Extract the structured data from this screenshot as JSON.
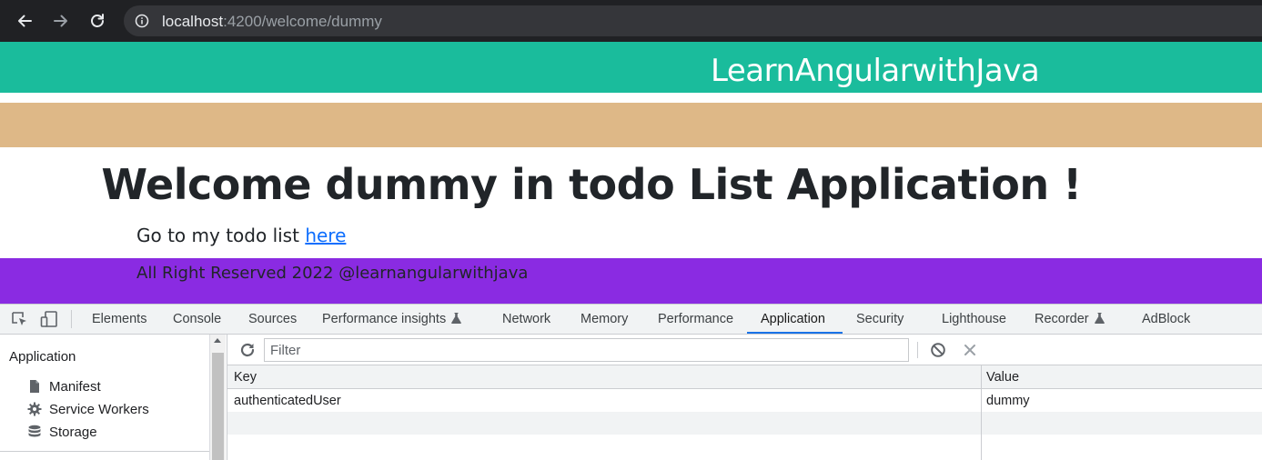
{
  "browser": {
    "url_host": "localhost",
    "url_rest": ":4200/welcome/dummy"
  },
  "page": {
    "brand": "LearnAngularwithJava",
    "welcome_title": "Welcome dummy in todo List Application !",
    "todo_text": "Go to my todo list",
    "todo_link": "here",
    "footer": "All Right Reserved 2022 @learnangularwithjava",
    "colors": {
      "header": "#1abc9c",
      "band": "#deb887",
      "footer": "#8a2be2"
    }
  },
  "devtools": {
    "tabs": [
      {
        "label": "Elements"
      },
      {
        "label": "Console"
      },
      {
        "label": "Sources"
      },
      {
        "label": "Performance insights"
      },
      {
        "label": "Network"
      },
      {
        "label": "Memory"
      },
      {
        "label": "Performance"
      },
      {
        "label": "Application",
        "active": true
      },
      {
        "label": "Security"
      },
      {
        "label": "Lighthouse"
      },
      {
        "label": "Recorder"
      },
      {
        "label": "AdBlock"
      }
    ],
    "sidebar": {
      "heading": "Application",
      "items": [
        {
          "label": "Manifest",
          "icon": "file-icon"
        },
        {
          "label": "Service Workers",
          "icon": "gear-icon"
        },
        {
          "label": "Storage",
          "icon": "database-icon"
        }
      ]
    },
    "filter_placeholder": "Filter",
    "table": {
      "columns": [
        "Key",
        "Value"
      ],
      "rows": [
        {
          "key": "authenticatedUser",
          "value": "dummy"
        }
      ]
    }
  }
}
